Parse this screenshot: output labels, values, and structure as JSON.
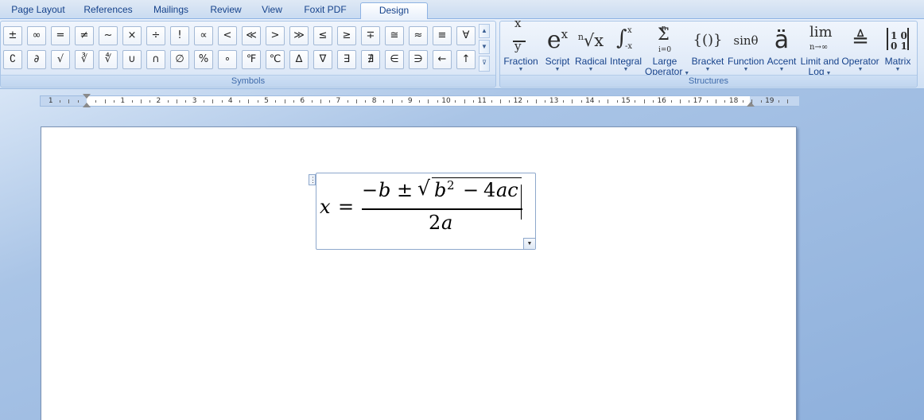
{
  "tabs": [
    {
      "label": "Page Layout",
      "active": false
    },
    {
      "label": "References",
      "active": false
    },
    {
      "label": "Mailings",
      "active": false
    },
    {
      "label": "Review",
      "active": false
    },
    {
      "label": "View",
      "active": false
    },
    {
      "label": "Foxit PDF",
      "active": false
    },
    {
      "label": "Design",
      "active": true
    }
  ],
  "symbols": {
    "group_label": "Symbols",
    "row1": [
      "±",
      "∞",
      "=",
      "≠",
      "~",
      "×",
      "÷",
      "!",
      "∝",
      "<",
      "≪",
      ">",
      "≫",
      "≤",
      "≥",
      "∓",
      "≅",
      "≈",
      "≡",
      "∀"
    ],
    "row2": [
      "∁",
      "∂",
      "√",
      "∛",
      "∜",
      "∪",
      "∩",
      "∅",
      "%",
      "∘",
      "℉",
      "℃",
      "∆",
      "∇",
      "∃",
      "∄",
      "∈",
      "∋",
      "←",
      "↑"
    ],
    "scroll_up": "▲",
    "scroll_down": "▼",
    "scroll_more": "⊽"
  },
  "structures": {
    "group_label": "Structures",
    "buttons": [
      {
        "id": "fraction",
        "icon_top": "x",
        "icon_bottom": "y",
        "label": "Fraction"
      },
      {
        "id": "script",
        "icon_base": "e",
        "icon_sup": "x",
        "label": "Script"
      },
      {
        "id": "radical",
        "icon_index": "n",
        "icon_symbol": "√x",
        "label": "Radical"
      },
      {
        "id": "integral",
        "icon_symbol": "∫",
        "icon_upper": "x",
        "icon_lower": "-x",
        "label": "Integral"
      },
      {
        "id": "large-operator",
        "icon_upper": "n",
        "icon_symbol": "Σ",
        "icon_lower": "i=0",
        "label": "Large",
        "label2": "Operator"
      },
      {
        "id": "bracket",
        "icon_symbol": "{()}",
        "label": "Bracket"
      },
      {
        "id": "function",
        "icon_symbol": "sinθ",
        "label": "Function"
      },
      {
        "id": "accent",
        "icon_symbol": "ä",
        "label": "Accent"
      },
      {
        "id": "limit-log",
        "icon_symbol": "lim",
        "icon_lower": "n→∞",
        "label": "Limit and",
        "label2": "Log"
      },
      {
        "id": "operator",
        "icon_symbol": "≜",
        "label": "Operator"
      },
      {
        "id": "matrix",
        "icon_symbol": "[1 0 / 0 1]",
        "label": "Matrix"
      }
    ]
  },
  "ruler": {
    "left_numbers": [
      "1"
    ],
    "numbers": [
      "1",
      "2",
      "3",
      "4",
      "5",
      "6",
      "7",
      "8",
      "9",
      "10",
      "11",
      "12",
      "13",
      "14",
      "15",
      "16",
      "17",
      "18",
      "19"
    ]
  },
  "equation": {
    "lhs": "x",
    "equals": "=",
    "numerator_minus": "−",
    "numerator_b": "b",
    "plus_minus": "±",
    "radical": "√",
    "radicand_b": "b",
    "exponent": "2",
    "minus": "−",
    "four": "4",
    "ac": "ac",
    "denominator_two": "2",
    "denominator_a": "a",
    "handle": "⋮",
    "dropdown": "▼"
  }
}
